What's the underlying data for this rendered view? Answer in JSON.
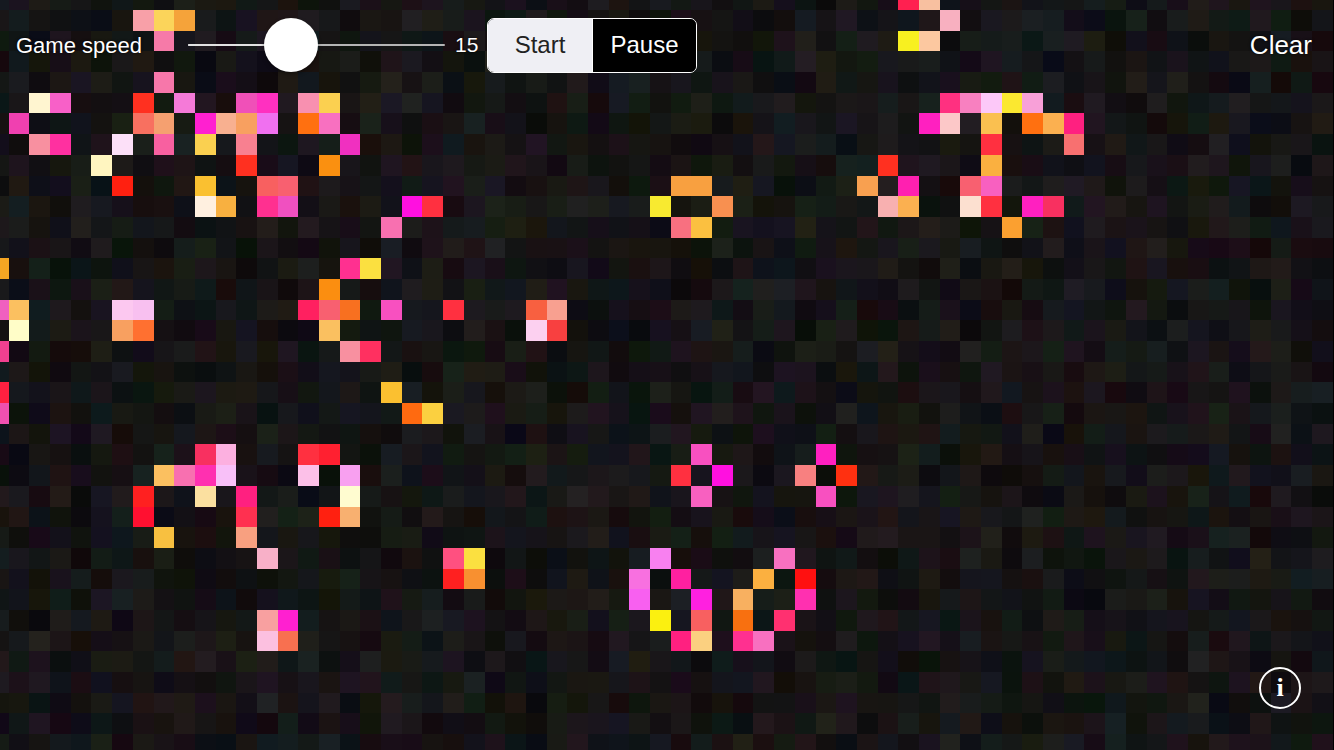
{
  "controls": {
    "speed_label": "Game speed",
    "speed": {
      "level": 0.4,
      "reading": "15"
    },
    "modes": [
      {
        "label": "Start",
        "selected": true
      },
      {
        "label": "Pause",
        "selected": false
      }
    ],
    "clear": "Clear",
    "info_icon": "i"
  },
  "board": {
    "cells": [
      {
        "row": 0,
        "col": 44,
        "color": "#ff2050"
      },
      {
        "row": 0,
        "col": 45,
        "color": "#f8c0a0"
      },
      {
        "row": 1,
        "col": 7,
        "color": "#f8a0a8"
      },
      {
        "row": 1,
        "col": 8,
        "color": "#fbd45a"
      },
      {
        "row": 1,
        "col": 9,
        "color": "#f5a33a"
      },
      {
        "row": 1,
        "col": 46,
        "color": "#f8b0c0"
      },
      {
        "row": 2,
        "col": 8,
        "color": "#f67aa8"
      },
      {
        "row": 2,
        "col": 44,
        "color": "#f8f020"
      },
      {
        "row": 2,
        "col": 45,
        "color": "#fcc8a0"
      },
      {
        "row": 4,
        "col": 8,
        "color": "#f777aa"
      },
      {
        "row": 5,
        "col": 2,
        "color": "#fff5d0"
      },
      {
        "row": 5,
        "col": 3,
        "color": "#f860c8"
      },
      {
        "row": 5,
        "col": 7,
        "color": "#ff3020"
      },
      {
        "row": 5,
        "col": 9,
        "color": "#f57ad8"
      },
      {
        "row": 5,
        "col": 12,
        "color": "#f050b8"
      },
      {
        "row": 5,
        "col": 13,
        "color": "#ff30c0"
      },
      {
        "row": 5,
        "col": 15,
        "color": "#f890b0"
      },
      {
        "row": 5,
        "col": 16,
        "color": "#fbd050"
      },
      {
        "row": 5,
        "col": 46,
        "color": "#ff3080"
      },
      {
        "row": 5,
        "col": 47,
        "color": "#f880c0"
      },
      {
        "row": 5,
        "col": 48,
        "color": "#fcc8f8"
      },
      {
        "row": 5,
        "col": 49,
        "color": "#fbe830"
      },
      {
        "row": 5,
        "col": 50,
        "color": "#f8a0d8"
      },
      {
        "row": 6,
        "col": 1,
        "color": "#f040b0"
      },
      {
        "row": 6,
        "col": 7,
        "color": "#f87060"
      },
      {
        "row": 6,
        "col": 8,
        "color": "#f5a070"
      },
      {
        "row": 6,
        "col": 10,
        "color": "#ff20d0"
      },
      {
        "row": 6,
        "col": 11,
        "color": "#f8b090"
      },
      {
        "row": 6,
        "col": 12,
        "color": "#f8a060"
      },
      {
        "row": 6,
        "col": 13,
        "color": "#f070f0"
      },
      {
        "row": 6,
        "col": 15,
        "color": "#ff7010"
      },
      {
        "row": 6,
        "col": 16,
        "color": "#f870c0"
      },
      {
        "row": 6,
        "col": 45,
        "color": "#ff20c0"
      },
      {
        "row": 6,
        "col": 46,
        "color": "#fcc8c8"
      },
      {
        "row": 6,
        "col": 48,
        "color": "#fac050"
      },
      {
        "row": 6,
        "col": 50,
        "color": "#ff7010"
      },
      {
        "row": 6,
        "col": 51,
        "color": "#fbb050"
      },
      {
        "row": 6,
        "col": 52,
        "color": "#ff2080"
      },
      {
        "row": 7,
        "col": 2,
        "color": "#f890a0"
      },
      {
        "row": 7,
        "col": 3,
        "color": "#ff30a0"
      },
      {
        "row": 7,
        "col": 6,
        "color": "#fce0f8"
      },
      {
        "row": 7,
        "col": 8,
        "color": "#f860a0"
      },
      {
        "row": 7,
        "col": 10,
        "color": "#fad050"
      },
      {
        "row": 7,
        "col": 12,
        "color": "#f88090"
      },
      {
        "row": 7,
        "col": 17,
        "color": "#f030c0"
      },
      {
        "row": 7,
        "col": 48,
        "color": "#ff3040"
      },
      {
        "row": 7,
        "col": 52,
        "color": "#f87070"
      },
      {
        "row": 8,
        "col": 5,
        "color": "#fff5c0"
      },
      {
        "row": 8,
        "col": 12,
        "color": "#ff3020"
      },
      {
        "row": 8,
        "col": 16,
        "color": "#fa9010"
      },
      {
        "row": 8,
        "col": 43,
        "color": "#ff3020"
      },
      {
        "row": 8,
        "col": 48,
        "color": "#fab040"
      },
      {
        "row": 9,
        "col": 6,
        "color": "#ff2010"
      },
      {
        "row": 9,
        "col": 10,
        "color": "#fac030"
      },
      {
        "row": 9,
        "col": 13,
        "color": "#f86060"
      },
      {
        "row": 9,
        "col": 14,
        "color": "#f86070"
      },
      {
        "row": 9,
        "col": 33,
        "color": "#f8a040"
      },
      {
        "row": 9,
        "col": 34,
        "color": "#f8a040"
      },
      {
        "row": 9,
        "col": 42,
        "color": "#f8a050"
      },
      {
        "row": 9,
        "col": 44,
        "color": "#ff20b0"
      },
      {
        "row": 9,
        "col": 47,
        "color": "#f86070"
      },
      {
        "row": 9,
        "col": 48,
        "color": "#f860c0"
      },
      {
        "row": 10,
        "col": 10,
        "color": "#fff0e0"
      },
      {
        "row": 10,
        "col": 11,
        "color": "#f8b040"
      },
      {
        "row": 10,
        "col": 13,
        "color": "#ff3090"
      },
      {
        "row": 10,
        "col": 14,
        "color": "#f050c0"
      },
      {
        "row": 10,
        "col": 20,
        "color": "#ff10e0"
      },
      {
        "row": 10,
        "col": 21,
        "color": "#ff3040"
      },
      {
        "row": 10,
        "col": 32,
        "color": "#f8ea30"
      },
      {
        "row": 10,
        "col": 35,
        "color": "#f89050"
      },
      {
        "row": 10,
        "col": 43,
        "color": "#f8b0b0"
      },
      {
        "row": 10,
        "col": 44,
        "color": "#fbb050"
      },
      {
        "row": 10,
        "col": 47,
        "color": "#fce0d0"
      },
      {
        "row": 10,
        "col": 48,
        "color": "#ff3040"
      },
      {
        "row": 10,
        "col": 50,
        "color": "#ff20c0"
      },
      {
        "row": 10,
        "col": 51,
        "color": "#f83060"
      },
      {
        "row": 11,
        "col": 19,
        "color": "#f870b0"
      },
      {
        "row": 11,
        "col": 33,
        "color": "#f87080"
      },
      {
        "row": 11,
        "col": 34,
        "color": "#fbc040"
      },
      {
        "row": 11,
        "col": 49,
        "color": "#fba030"
      },
      {
        "row": 13,
        "col": 0,
        "color": "#f5a623"
      },
      {
        "row": 13,
        "col": 17,
        "color": "#ff3090"
      },
      {
        "row": 13,
        "col": 18,
        "color": "#fbe040"
      },
      {
        "row": 14,
        "col": 16,
        "color": "#fb8e10"
      },
      {
        "row": 15,
        "col": 0,
        "color": "#f060c0"
      },
      {
        "row": 15,
        "col": 1,
        "color": "#fbc060"
      },
      {
        "row": 15,
        "col": 6,
        "color": "#fcc8f0"
      },
      {
        "row": 15,
        "col": 7,
        "color": "#f8c0f0"
      },
      {
        "row": 15,
        "col": 15,
        "color": "#ff2060"
      },
      {
        "row": 15,
        "col": 16,
        "color": "#f86070"
      },
      {
        "row": 15,
        "col": 17,
        "color": "#f87020"
      },
      {
        "row": 15,
        "col": 19,
        "color": "#f850c0"
      },
      {
        "row": 15,
        "col": 22,
        "color": "#ff3040"
      },
      {
        "row": 15,
        "col": 26,
        "color": "#f86040"
      },
      {
        "row": 15,
        "col": 27,
        "color": "#f8a090"
      },
      {
        "row": 16,
        "col": 1,
        "color": "#fffdc8"
      },
      {
        "row": 16,
        "col": 6,
        "color": "#f8a060"
      },
      {
        "row": 16,
        "col": 7,
        "color": "#ff7030"
      },
      {
        "row": 16,
        "col": 16,
        "color": "#fac060"
      },
      {
        "row": 16,
        "col": 26,
        "color": "#fcd0f0"
      },
      {
        "row": 16,
        "col": 27,
        "color": "#f84040"
      },
      {
        "row": 17,
        "col": 0,
        "color": "#f04090"
      },
      {
        "row": 17,
        "col": 17,
        "color": "#f890a0"
      },
      {
        "row": 17,
        "col": 18,
        "color": "#ff3060"
      },
      {
        "row": 19,
        "col": 0,
        "color": "#ff2040"
      },
      {
        "row": 19,
        "col": 19,
        "color": "#fbc030"
      },
      {
        "row": 20,
        "col": 0,
        "color": "#f050b0"
      },
      {
        "row": 20,
        "col": 20,
        "color": "#ff6a10"
      },
      {
        "row": 20,
        "col": 21,
        "color": "#fbd040"
      },
      {
        "row": 22,
        "col": 10,
        "color": "#f83060"
      },
      {
        "row": 22,
        "col": 11,
        "color": "#fcb0e0"
      },
      {
        "row": 22,
        "col": 15,
        "color": "#ff3040"
      },
      {
        "row": 22,
        "col": 16,
        "color": "#ff2030"
      },
      {
        "row": 22,
        "col": 34,
        "color": "#f850c0"
      },
      {
        "row": 22,
        "col": 40,
        "color": "#ff20c0"
      },
      {
        "row": 23,
        "col": 8,
        "color": "#fbc060"
      },
      {
        "row": 23,
        "col": 9,
        "color": "#f870b0"
      },
      {
        "row": 23,
        "col": 10,
        "color": "#ff30b0"
      },
      {
        "row": 23,
        "col": 11,
        "color": "#f8c0f8"
      },
      {
        "row": 23,
        "col": 15,
        "color": "#fcc0e8"
      },
      {
        "row": 23,
        "col": 17,
        "color": "#f8a0f0"
      },
      {
        "row": 23,
        "col": 33,
        "color": "#ff3040"
      },
      {
        "row": 23,
        "col": 35,
        "color": "#ff10e0"
      },
      {
        "row": 23,
        "col": 39,
        "color": "#f88080"
      },
      {
        "row": 23,
        "col": 41,
        "color": "#ff3010"
      },
      {
        "row": 24,
        "col": 7,
        "color": "#ff2020"
      },
      {
        "row": 24,
        "col": 10,
        "color": "#fbe0a0"
      },
      {
        "row": 24,
        "col": 12,
        "color": "#ff2080"
      },
      {
        "row": 24,
        "col": 17,
        "color": "#fffcd0"
      },
      {
        "row": 24,
        "col": 34,
        "color": "#f860c0"
      },
      {
        "row": 24,
        "col": 40,
        "color": "#f850c0"
      },
      {
        "row": 25,
        "col": 7,
        "color": "#ff1030"
      },
      {
        "row": 25,
        "col": 12,
        "color": "#ff3050"
      },
      {
        "row": 25,
        "col": 16,
        "color": "#ff2010"
      },
      {
        "row": 25,
        "col": 17,
        "color": "#f8b070"
      },
      {
        "row": 26,
        "col": 8,
        "color": "#f8c040"
      },
      {
        "row": 26,
        "col": 12,
        "color": "#f8a080"
      },
      {
        "row": 27,
        "col": 13,
        "color": "#f8b0c8"
      },
      {
        "row": 27,
        "col": 22,
        "color": "#ff5080"
      },
      {
        "row": 27,
        "col": 23,
        "color": "#fbe040"
      },
      {
        "row": 27,
        "col": 32,
        "color": "#f880f0"
      },
      {
        "row": 27,
        "col": 38,
        "color": "#f870c0"
      },
      {
        "row": 28,
        "col": 22,
        "color": "#ff2020"
      },
      {
        "row": 28,
        "col": 23,
        "color": "#f89030"
      },
      {
        "row": 28,
        "col": 31,
        "color": "#f870e0"
      },
      {
        "row": 28,
        "col": 33,
        "color": "#ff20a0"
      },
      {
        "row": 28,
        "col": 37,
        "color": "#fbb040"
      },
      {
        "row": 28,
        "col": 39,
        "color": "#ff1010"
      },
      {
        "row": 29,
        "col": 31,
        "color": "#f860f0"
      },
      {
        "row": 29,
        "col": 34,
        "color": "#ff20e0"
      },
      {
        "row": 29,
        "col": 36,
        "color": "#f8b060"
      },
      {
        "row": 29,
        "col": 39,
        "color": "#ff30b0"
      },
      {
        "row": 30,
        "col": 13,
        "color": "#f8a0a0"
      },
      {
        "row": 30,
        "col": 14,
        "color": "#ff20d0"
      },
      {
        "row": 30,
        "col": 32,
        "color": "#fbf010"
      },
      {
        "row": 30,
        "col": 34,
        "color": "#f86060"
      },
      {
        "row": 30,
        "col": 36,
        "color": "#f87010"
      },
      {
        "row": 30,
        "col": 38,
        "color": "#ff3070"
      },
      {
        "row": 31,
        "col": 13,
        "color": "#fcc0e0"
      },
      {
        "row": 31,
        "col": 14,
        "color": "#f87050"
      },
      {
        "row": 31,
        "col": 33,
        "color": "#ff2080"
      },
      {
        "row": 31,
        "col": 34,
        "color": "#fbd080"
      },
      {
        "row": 31,
        "col": 36,
        "color": "#ff3090"
      },
      {
        "row": 31,
        "col": 37,
        "color": "#f870c0"
      }
    ]
  }
}
